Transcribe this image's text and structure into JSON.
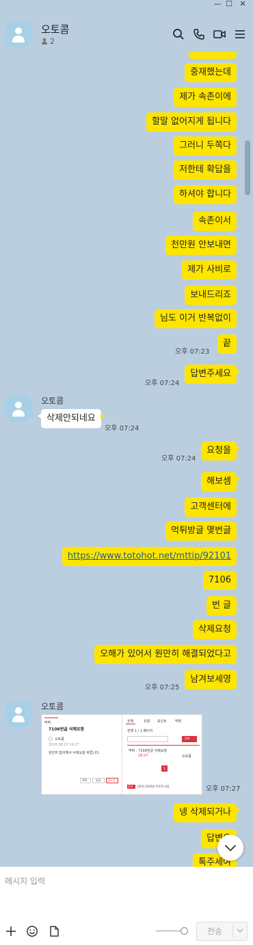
{
  "window": {
    "minimize": "—",
    "maximize": "☐",
    "close": "✕"
  },
  "header": {
    "title": "오토콤",
    "member_count": "2",
    "icons": [
      "search-icon",
      "phone-icon",
      "video-call-icon",
      "menu-icon"
    ]
  },
  "messages": {
    "m01": "중재했는데",
    "m02": "제가 속촌이에",
    "m03": "할말 없어지게 됩니다",
    "m04": "그러니 두쪽다",
    "m05": "저한테 확답을",
    "m06": "하셔야 합니다",
    "m07": "속촌이서",
    "m08": "천만원 안보내면",
    "m09": "제가 사비로",
    "m10": "보내드리죠",
    "m11": "님도 이거 반복없이",
    "m12": "끝",
    "t12": "오후 07:23",
    "m13": "답변주세요",
    "t13": "오후 07:24",
    "s14": "오토콤",
    "m14": "삭제안되네요",
    "t14": "오후 07:24",
    "m15": "요청을",
    "t15": "오후 07:24",
    "m16": "해보셈",
    "m17": "고객센터에",
    "m18": "먹튀방글 몇번글",
    "m19": "https://www.totohot.net/mttip/92101",
    "m20": "7106",
    "m21": "번 글",
    "m22": "삭제요청",
    "m23": "오해가 있어서 원만히 해결되었다고",
    "m24": "남겨보세영",
    "t24": "오후 07:25",
    "s25": "오토콤",
    "t25": "오후 07:27",
    "m26": "넹 삭제되거나",
    "m27": "답변오",
    "m28": "톡주세여"
  },
  "shot": {
    "left_tab": "먹튀",
    "left_title": "7106번글 삭제요청",
    "left_author": "오토콤",
    "left_date": "2026.08.15 19:27",
    "left_body": "원만히 합의해서 삭제요청 바랍니다.",
    "btn_list": "목록",
    "btn_reply": "답글",
    "btn_write": "글쓰기",
    "tabs": [
      "전체",
      "유형",
      "포인트",
      "먹튀"
    ],
    "page_info": "전체 1 / 1 페이지",
    "search_btn": "검색",
    "row_title": "먹튀 : 7106번글 삭제요청",
    "row_date": "18:27",
    "row_author": "오토콤",
    "page_num": "1",
    "notice_tag": "공지",
    "notice_text": "[필독] 2026년 토토핫 보증"
  },
  "input": {
    "placeholder": "메시지 입력",
    "send_label": "전송"
  },
  "colors": {
    "chat_bg": "#bacee0",
    "my_bubble": "#fee500",
    "their_bubble": "#ffffff",
    "avatar": "#a7d0e6"
  }
}
